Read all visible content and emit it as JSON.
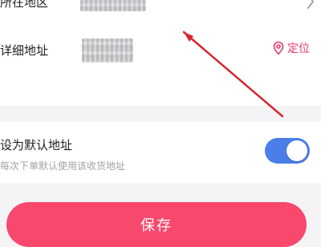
{
  "address": {
    "region_label": "所在地区",
    "detail_label": "详细地址",
    "locate_label": "定位",
    "locate_icon": "location-pin-icon",
    "region_chevron_icon": "chevron-right-icon"
  },
  "default_address": {
    "label": "设为默认地址",
    "subtitle": "每次下单默认使用该收货地址",
    "enabled": true
  },
  "actions": {
    "save_label": "保存"
  },
  "colors": {
    "accent_pink": "#f8486e",
    "toggle_blue": "#4b7ee8",
    "locate_pink": "#e8396b",
    "annotation_red": "#d6262e"
  }
}
